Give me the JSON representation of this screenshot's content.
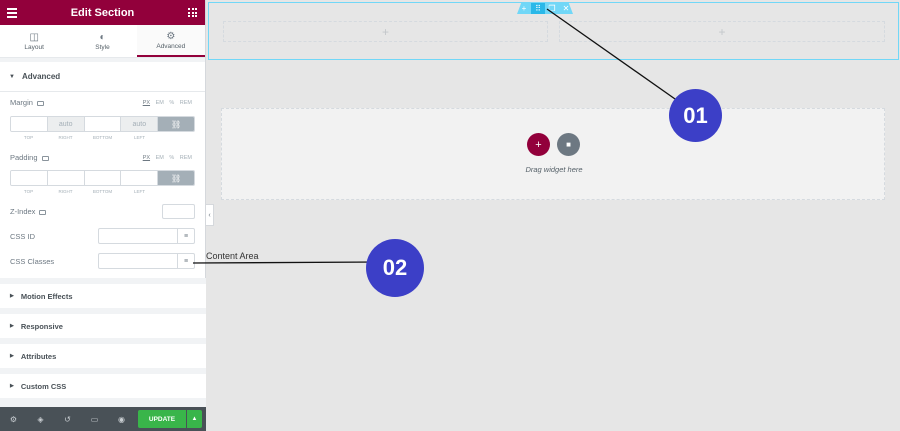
{
  "panel": {
    "title": "Edit Section",
    "tabs": [
      {
        "label": "Layout",
        "icon": "layout-icon"
      },
      {
        "label": "Style",
        "icon": "half-circle-icon"
      },
      {
        "label": "Advanced",
        "icon": "gear-icon"
      }
    ],
    "active_tab": "Advanced",
    "advanced_heading": "Advanced",
    "margin": {
      "label": "Margin",
      "units": [
        "PX",
        "EM",
        "%",
        "REM"
      ],
      "active_unit": "PX",
      "values": [
        "",
        "auto",
        "",
        "auto"
      ],
      "sides": [
        "TOP",
        "RIGHT",
        "BOTTOM",
        "LEFT"
      ]
    },
    "padding": {
      "label": "Padding",
      "units": [
        "PX",
        "EM",
        "%",
        "REM"
      ],
      "active_unit": "PX",
      "values": [
        "",
        "",
        "",
        ""
      ],
      "sides": [
        "TOP",
        "RIGHT",
        "BOTTOM",
        "LEFT"
      ]
    },
    "zindex_label": "Z-Index",
    "cssid_label": "CSS ID",
    "cssclasses_label": "CSS Classes",
    "collapsed_sections": [
      "Motion Effects",
      "Responsive",
      "Attributes",
      "Custom CSS"
    ],
    "footer": {
      "icons": [
        "settings-icon",
        "layers-icon",
        "history-icon",
        "responsive-icon",
        "preview-eye-icon"
      ],
      "update_label": "UPDATE"
    }
  },
  "canvas": {
    "drop_text": "Drag widget here",
    "annotation_label": "Content Area",
    "callouts": [
      "01",
      "02"
    ],
    "colors": {
      "accent": "#92003b",
      "callout": "#3c3fc7",
      "handle": "#71d7f7",
      "update": "#39b54a"
    }
  }
}
